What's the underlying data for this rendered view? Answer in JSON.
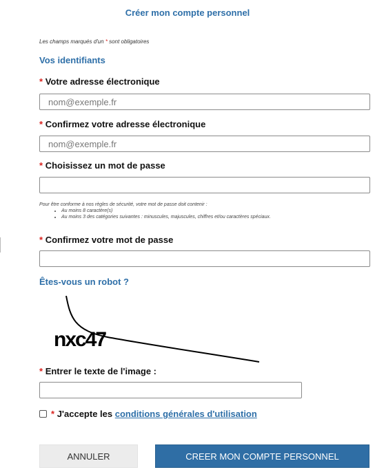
{
  "page": {
    "title": "Créer mon compte personnel",
    "required_note_prefix": "Les champs marqués d'un",
    "required_note_suffix": "sont obligatoires",
    "required_marker": "*"
  },
  "credentials": {
    "section_title": "Vos identifiants",
    "email_label": "Votre adresse électronique",
    "email_placeholder": "nom@exemple.fr",
    "email_value": "",
    "confirm_email_label": "Confirmez votre adresse électronique",
    "confirm_email_placeholder": "nom@exemple.fr",
    "confirm_email_value": "",
    "password_label": "Choisissez un mot de passe",
    "password_value": "",
    "password_rules": {
      "intro": "Pour être conforme à nos règles de sécurité, votre mot de passe doit contenir :",
      "items": [
        "Au moins 8 caractère(s)",
        "Au moins 3 des catégories suivantes : minuscules, majuscules, chiffres et/ou caractères spéciaux."
      ]
    },
    "confirm_password_label": "Confirmez votre mot de passe",
    "confirm_password_value": ""
  },
  "robot": {
    "section_title": "Êtes-vous un robot ?",
    "captcha_text": "nxc47",
    "input_label": "Entrer le texte de l'image :",
    "input_value": ""
  },
  "terms": {
    "checked": false,
    "prefix": "J'accepte les",
    "link_text": "conditions générales d'utilisation"
  },
  "buttons": {
    "cancel_label": "ANNULER",
    "create_label": "CREER MON COMPTE PERSONNEL"
  },
  "colors": {
    "accent": "#2e6fa8",
    "required_star": "#d9231f",
    "primary_button": "#2f6ea5",
    "secondary_button": "#ececec"
  }
}
